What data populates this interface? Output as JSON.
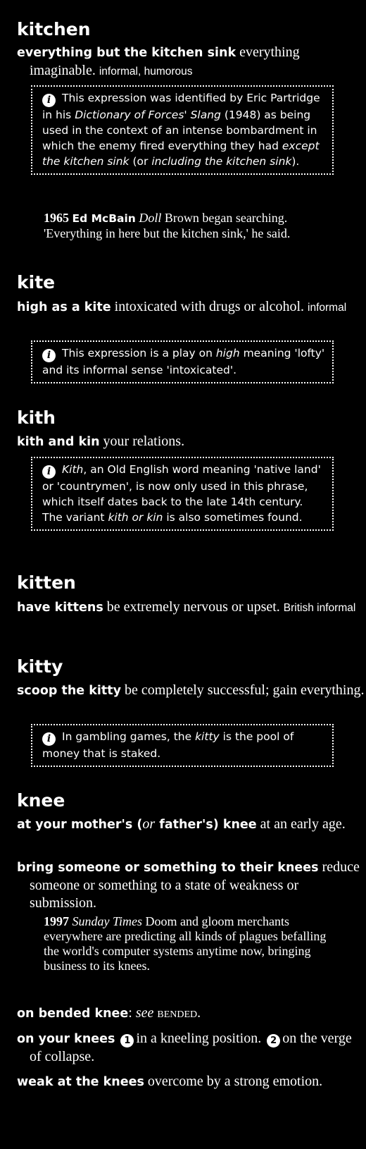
{
  "entries": {
    "kitchen": {
      "headword": "kitchen",
      "sense_phrase": "everything but the kitchen sink",
      "sense_def": "everything imaginable.",
      "sense_register": "informal, humorous",
      "note_a": "This expression was identified by Eric Partridge in his ",
      "note_b": "Dictionary of Forces' Slang",
      "note_c": " (1948) as being used in the context of an intense bombardment in which the enemy fired everything they had ",
      "note_d": "except the kitchen sink",
      "note_e": " (or ",
      "note_f": "including the kitchen sink",
      "note_g": ").",
      "cite_year": "1965",
      "cite_author": "Ed McBain",
      "cite_work": "Doll",
      "cite_text": "Brown began searching. 'Everything in here but the kitchen sink,' he said."
    },
    "kite": {
      "headword": "kite",
      "sense_phrase": "high as a kite",
      "sense_def": "intoxicated with drugs or alcohol.",
      "sense_register": "informal",
      "note_a": "This expression is a play on ",
      "note_b": "high",
      "note_c": " meaning 'lofty' and its informal sense 'intoxicated'."
    },
    "kith": {
      "headword": "kith",
      "sense_phrase": "kith and kin",
      "sense_def": "your relations.",
      "note_a": "Kith",
      "note_b": ", an Old English word meaning 'native land' or 'countrymen', is now only used in this phrase, which itself dates back to the late 14th century. The variant ",
      "note_c": "kith or kin",
      "note_d": " is also sometimes found."
    },
    "kitten": {
      "headword": "kitten",
      "sense_phrase": "have kittens",
      "sense_def": "be extremely nervous or upset.",
      "sense_register": "British informal"
    },
    "kitty": {
      "headword": "kitty",
      "sense_phrase": "scoop the kitty",
      "sense_def": "be completely successful; gain everything.",
      "note_a": "In gambling games, the ",
      "note_b": "kitty",
      "note_c": " is the pool of money that is staked."
    },
    "knee": {
      "headword": "knee",
      "s1_phrase_a": "at your mother's (",
      "s1_or": "or",
      "s1_phrase_b": " father's) knee",
      "s1_def": "at an early age.",
      "s2_phrase": "bring someone or something to their knees",
      "s2_def": "reduce someone or something to a state of weakness or submission.",
      "cite_year": "1997",
      "cite_work": "Sunday Times",
      "cite_text": "Doom and gloom merchants everywhere are predicting all kinds of plagues befalling the world's computer systems anytime now, bringing business to its knees.",
      "s3_phrase": "on bended knee",
      "s3_see": "see",
      "s3_ref": "bended",
      "s4_phrase": "on your knees",
      "s4_n1": "1",
      "s4_def1": "in a kneeling position.",
      "s4_n2": "2",
      "s4_def2": "on the verge of collapse.",
      "s5_phrase": "weak at the knees",
      "s5_def": "overcome by a strong emotion."
    }
  },
  "icons": {
    "info": "i"
  }
}
